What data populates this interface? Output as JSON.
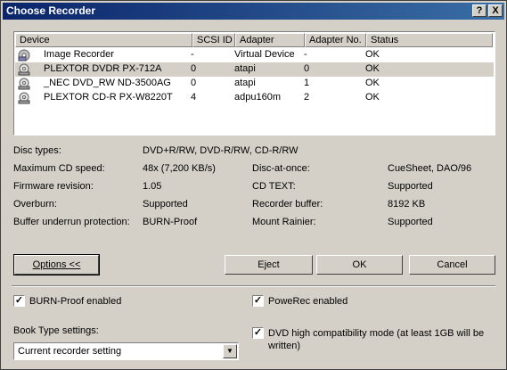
{
  "window": {
    "title": "Choose Recorder",
    "help_label": "?",
    "close_label": "X"
  },
  "table": {
    "headers": [
      "Device",
      "SCSI ID",
      "Adapter",
      "Adapter No.",
      "Status"
    ],
    "rows": [
      {
        "device": "Image Recorder",
        "scsi": "-",
        "adapter": "Virtual Device",
        "adapter_no": "-",
        "status": "OK",
        "icon": "image-recorder-icon"
      },
      {
        "device": "PLEXTOR  DVDR   PX-712A",
        "scsi": "0",
        "adapter": "atapi",
        "adapter_no": "0",
        "status": "OK",
        "icon": "cd-drive-icon"
      },
      {
        "device": "_NEC     DVD_RW ND-3500AG",
        "scsi": "0",
        "adapter": "atapi",
        "adapter_no": "1",
        "status": "OK",
        "icon": "cd-drive-icon"
      },
      {
        "device": "PLEXTOR  CD-R   PX-W8220T",
        "scsi": "4",
        "adapter": "adpu160m",
        "adapter_no": "2",
        "status": "OK",
        "icon": "cd-drive-icon"
      }
    ],
    "selected_row": 1
  },
  "info": {
    "disc_types_label": "Disc types:",
    "disc_types": "DVD+R/RW, DVD-R/RW, CD-R/RW",
    "max_speed_label": "Maximum CD speed:",
    "max_speed": "48x (7,200 KB/s)",
    "firmware_label": "Firmware revision:",
    "firmware": "1.05",
    "overburn_label": "Overburn:",
    "overburn": "Supported",
    "underrun_label": "Buffer underrun protection:",
    "underrun": "BURN-Proof",
    "dao_label": "Disc-at-once:",
    "dao": "CueSheet, DAO/96",
    "cdtext_label": "CD TEXT:",
    "cdtext": "Supported",
    "buffer_label": "Recorder buffer:",
    "buffer": "8192 KB",
    "rainier_label": "Mount Rainier:",
    "rainier": "Supported"
  },
  "buttons": {
    "options": "Options <<",
    "eject": "Eject",
    "ok": "OK",
    "cancel": "Cancel"
  },
  "options": {
    "burnproof_label": "BURN-Proof enabled",
    "burnproof_checked": true,
    "powerec_label": "PoweRec enabled",
    "powerec_checked": true,
    "booktype_label": "Book Type settings:",
    "booktype_value": "Current recorder setting",
    "dvd_compat_label_1": "DVD high compatibility mode (at least 1GB will be",
    "dvd_compat_label_2": "written)",
    "dvd_compat_checked": true
  }
}
